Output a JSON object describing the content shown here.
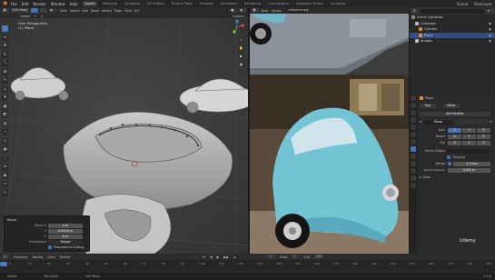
{
  "topbar": {
    "menus": [
      "File",
      "Edit",
      "Render",
      "Window",
      "Help"
    ],
    "workspaces": [
      "Layout",
      "Modeling",
      "Sculpting",
      "UV Editing",
      "Texture Paint",
      "Shading",
      "Animation",
      "Rendering",
      "Compositing",
      "Geometry Nodes",
      "Scripting"
    ],
    "active_workspace": "Layout",
    "scene": "Scene",
    "view_layer": "ViewLayer"
  },
  "viewport": {
    "mode": "Edit Mode",
    "menus": [
      "View",
      "Select",
      "Add",
      "Mesh",
      "Vertex",
      "Edge",
      "Face",
      "UV"
    ],
    "view_name": "User Perspective",
    "object_name": "(1) Plane",
    "orientation": "Global",
    "options": "Options"
  },
  "move_panel": {
    "title": "Move",
    "rows": [
      {
        "label": "Move X",
        "value": "0 m"
      },
      {
        "label": "Y",
        "value": "0.0416 m"
      },
      {
        "label": "Z",
        "value": "0 m"
      },
      {
        "label": "Orientation",
        "value": "Global"
      }
    ],
    "proportional_label": "Proportional Editing"
  },
  "image_editor": {
    "menus": [
      "View",
      "Image"
    ],
    "image_name": "reference.jpg"
  },
  "outliner": {
    "title": "Scene Collection",
    "items": [
      {
        "label": "Scene Collection",
        "indent": 0,
        "selected": false,
        "color": "#888888"
      },
      {
        "label": "Collection",
        "indent": 1,
        "selected": false,
        "color": "#bbbbbb"
      },
      {
        "label": "Cylinder",
        "indent": 2,
        "selected": false,
        "color": "#e8872b"
      },
      {
        "label": "Plane",
        "indent": 2,
        "selected": true,
        "color": "#e8872b"
      },
      {
        "label": "Images",
        "indent": 1,
        "selected": false,
        "color": "#bbbbbb"
      }
    ]
  },
  "properties": {
    "object": "Plane",
    "tabs": [
      "Tool",
      "Mirror"
    ],
    "modifier_add": "Add Modifier",
    "modifier_name": "Mirror",
    "axis_label": "Axis",
    "bisect_label": "Bisect",
    "flip_label": "Flip",
    "axes": [
      "X",
      "Y",
      "Z"
    ],
    "mirror_object_label": "Mirror Object",
    "clipping_label": "Clipping",
    "merge_label": "Merge",
    "merge_value": "0.1 mm",
    "bisect_distance_label": "Bisect Distance",
    "bisect_distance_value": "0.001 m",
    "data_label": "Data"
  },
  "timeline": {
    "menus": [
      "Playback",
      "Keying",
      "View",
      "Marker"
    ],
    "frame_numbers": [
      "0",
      "10",
      "20",
      "30",
      "40",
      "50",
      "60",
      "70",
      "80",
      "90",
      "100",
      "110",
      "120",
      "130",
      "140",
      "150",
      "160",
      "170",
      "180",
      "190",
      "200",
      "210",
      "220",
      "230",
      "240",
      "250"
    ],
    "current_frame": "1",
    "start_label": "Start",
    "start": "1",
    "end_label": "End",
    "end": "250"
  },
  "statusbar": {
    "items": [
      "Select",
      "Pan View",
      "Call Menu"
    ],
    "version": "3.0.0"
  },
  "watermark": "Udemy"
}
